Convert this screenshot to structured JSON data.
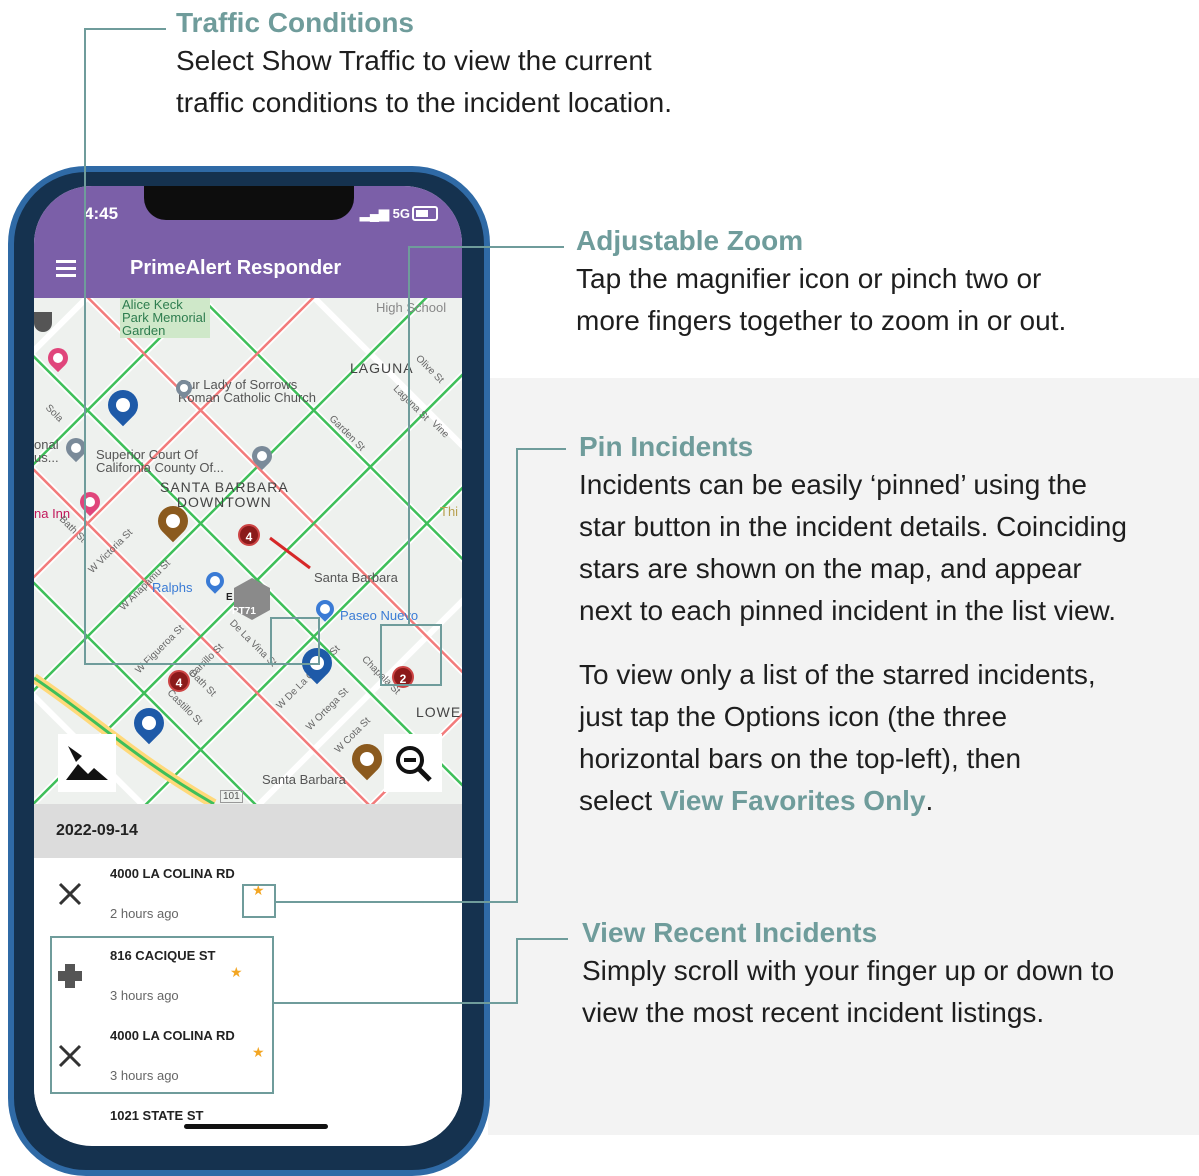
{
  "callouts": {
    "traffic": {
      "title": "Traffic Conditions",
      "body": [
        "Select Show Traffic to view the current",
        "traffic conditions to the incident location."
      ]
    },
    "zoom": {
      "title": "Adjustable Zoom",
      "body": [
        "Tap the magnifier icon or pinch two or",
        "more fingers together to zoom in or out."
      ]
    },
    "pin": {
      "title": "Pin Incidents",
      "body": [
        "Incidents can be easily ‘pinned’ using the",
        "star button in the incident details. Coinciding",
        "stars are shown on the map, and appear",
        "next to each pinned incident in the list view."
      ],
      "body2": [
        "To view only a list of the starred incidents,",
        "just tap the Options icon (the three",
        "horizontal bars on the top-left), then"
      ],
      "body2_last_prefix": "select ",
      "body2_link": "View Favorites Only",
      "body2_last_suffix": "."
    },
    "recent": {
      "title": "View Recent Incidents",
      "body": [
        "Simply scroll with your finger up or down to",
        "view the most recent incident listings."
      ]
    }
  },
  "phone": {
    "time": "4:45",
    "network": "5G",
    "app_title": "PrimeAlert Responder",
    "map_labels": {
      "park": "Alice Keck\nPark Memorial\nGarden",
      "high_school": "High School",
      "laguna": "LAGUNA",
      "church": "Our Lady of Sorrows\nRoman Catholic Church",
      "court": "Superior Court Of\nCalifornia County Of...",
      "downtown": "SANTA BARBARA\nDOWNTOWN",
      "national": "onal\nus...",
      "inn": "na Inn",
      "ralphs": "Ralphs",
      "santa_barbara": "Santa Barbara",
      "paseo": "Paseo Nuevo",
      "pt71": "PT71",
      "e": "E",
      "lowe": "LOWE",
      "santa_barbara2": "Santa Barbara",
      "hwy": "101",
      "th": "Thi",
      "garden_st": "Garden St",
      "laguna_st": "Laguna St",
      "olive_st": "Olive St",
      "vine": "Vine",
      "bath_st": "Bath St",
      "victoria_st": "W Victoria St",
      "anapamu_st": "W Anapamu St",
      "figueroa_st": "W Figueroa St",
      "carrillo_st": "W Carrillo St",
      "la_vina_st": "De La Vina St",
      "de_la_guerra": "W De La Guerra St",
      "ortega": "W Ortega St",
      "cota": "W Cota St",
      "chapala": "Chapala St",
      "castillo": "Castillo St",
      "bath_st2": "Bath St",
      "sola": "Sola"
    },
    "cluster_counts": [
      "4",
      "2",
      "4"
    ],
    "date": "2022-09-14",
    "incidents": [
      {
        "address": "4000 LA COLINA RD",
        "time_ago": "2 hours ago",
        "star": "★"
      },
      {
        "address": "816 CACIQUE ST",
        "time_ago": "3 hours ago",
        "star": "★"
      },
      {
        "address": "4000 LA COLINA RD",
        "time_ago": "3 hours ago",
        "star": "★"
      },
      {
        "address": "1021 STATE ST"
      }
    ]
  },
  "colors": {
    "accent": "#6f9c9b",
    "app_bar": "#7b5fa8",
    "star": "#f3a623",
    "phone_frame": "#2f6aa6"
  },
  "icons": [
    "menu-icon",
    "tools-icon",
    "medical-cross-icon",
    "star-icon",
    "zoom-out-icon",
    "map-layers-icon",
    "fire-pin-icon",
    "medical-pin-icon"
  ]
}
